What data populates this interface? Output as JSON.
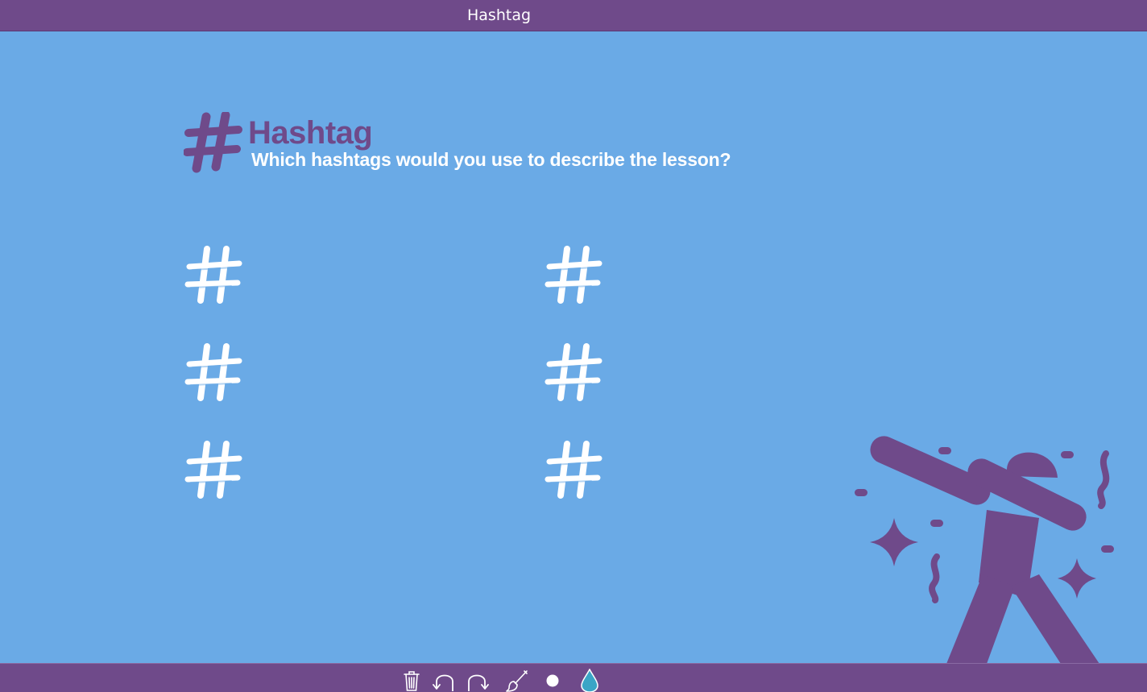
{
  "window": {
    "title": "Hashtag"
  },
  "slide": {
    "heading_title": "Hashtag",
    "heading_subtitle": "Which hashtags would you use to describe the lesson?",
    "hashtag_slots": [
      {
        "label": "#"
      },
      {
        "label": "#"
      },
      {
        "label": "#"
      },
      {
        "label": "#"
      },
      {
        "label": "#"
      },
      {
        "label": "#"
      }
    ],
    "illustration": "dabbing-person-icon"
  },
  "toolbar": {
    "tools": [
      {
        "name": "trash-icon"
      },
      {
        "name": "undo-icon"
      },
      {
        "name": "redo-icon"
      },
      {
        "name": "brush-icon"
      },
      {
        "name": "brush-size-icon"
      },
      {
        "name": "color-drop-icon"
      }
    ]
  },
  "colors": {
    "header_bar": "#6f4a8a",
    "canvas_background": "#6aaae6",
    "accent_purple": "#6f4a8a",
    "hashtag_white": "#ffffff",
    "drop_teal": "#3aa5c6"
  }
}
